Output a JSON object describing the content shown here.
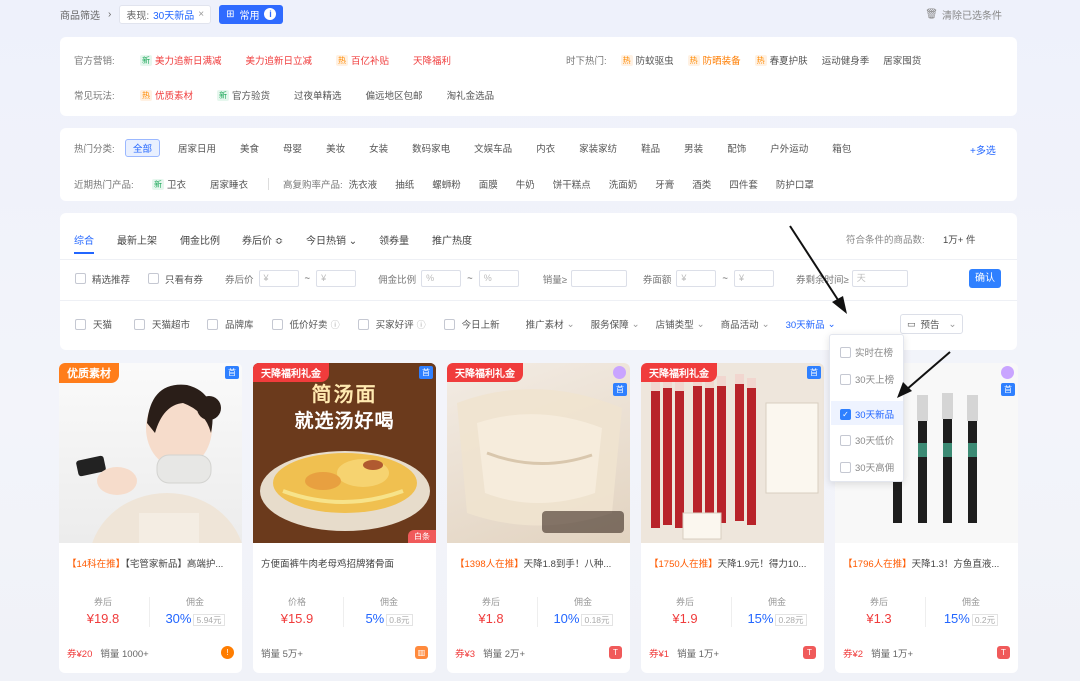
{
  "breadcrumb": {
    "root": "商品筛选",
    "chip_prefix": "表现:",
    "chip_value": "30天新品",
    "common_label": "常用",
    "clear_label": "清除已选条件"
  },
  "marketing": {
    "label": "官方营销:",
    "items": [
      {
        "badge": "新",
        "text": "美力追新日满减"
      },
      {
        "text": "美力追新日立减"
      },
      {
        "badge": "热",
        "text": "百亿补贴"
      },
      {
        "text": "天降福利"
      }
    ],
    "hot_label": "时下热门:",
    "hot_items": [
      {
        "badge": "热",
        "text": "防蚊驱虫"
      },
      {
        "badge": "热",
        "text": "防晒装备"
      },
      {
        "badge": "热",
        "text": "春夏护肤"
      },
      {
        "text": "运动健身季"
      },
      {
        "text": "居家囤货"
      }
    ]
  },
  "gameplay": {
    "label": "常见玩法:",
    "items": [
      {
        "badge": "热",
        "text": "优质素材"
      },
      {
        "badge": "新",
        "text": "官方验货"
      },
      {
        "text": "过夜单精选"
      },
      {
        "text": "偏远地区包邮"
      },
      {
        "text": "淘礼金选品"
      }
    ]
  },
  "categories": {
    "label": "热门分类:",
    "items": [
      "全部",
      "居家日用",
      "美食",
      "母婴",
      "美妆",
      "女装",
      "数码家电",
      "文娱车品",
      "内衣",
      "家装家纺",
      "鞋品",
      "男装",
      "配饰",
      "户外运动",
      "箱包"
    ],
    "more": "+多选"
  },
  "recent": {
    "label": "近期热门产品:",
    "items": [
      {
        "badge": "新",
        "text": "卫衣"
      },
      {
        "text": "居家睡衣"
      }
    ],
    "high_label": "高复购率产品:",
    "high_items": [
      "洗衣液",
      "抽纸",
      "螺蛳粉",
      "面膜",
      "牛奶",
      "饼干糕点",
      "洗面奶",
      "牙膏",
      "酒类",
      "四件套",
      "防护口罩"
    ]
  },
  "sort": {
    "tabs": [
      "综合",
      "最新上架",
      "佣金比例",
      "券后价 ≎",
      "今日热销 ⌄",
      "领券量",
      "推广热度"
    ],
    "count_label": "符合条件的商品数:",
    "count_value": "1万+ 件"
  },
  "filters": {
    "featured": "精选推荐",
    "coupon_only": "只看有券",
    "after_price": "券后价",
    "yen": "¥",
    "tilde": "~",
    "commission_rate": "佣金比例",
    "pct": "%",
    "sales": "销量≥",
    "coupon_value": "券面额",
    "coupon_time": "券剩余时间≥",
    "day": "天",
    "confirm": "确认"
  },
  "filters2": {
    "checks": [
      "天猫",
      "天猫超市",
      "品牌库",
      "低价好卖",
      "买家好评",
      "今日上新"
    ],
    "dropdowns": [
      "推广素材",
      "服务保障",
      "店铺类型",
      "商品活动"
    ],
    "active_dropdown": "30天新品",
    "preview": "预告"
  },
  "dropdown": {
    "items": [
      "实时在榜",
      "30天上榜",
      "30天新品",
      "30天低价",
      "30天高佣"
    ],
    "selected": "30天新品"
  },
  "products": [
    {
      "corner": "优质素材",
      "corner_color": "#ff7d1a",
      "title_hl": "【14科在推】",
      "title": "【宅管家新品】高端护...",
      "stat_l": "券后",
      "price_l": "¥19.8",
      "stat_r": "佣金",
      "price_r": "30%",
      "price_r_small": "5.94元",
      "coupon": "券¥20",
      "sales": "销量 1000+",
      "icon_color": "#ff7d00"
    },
    {
      "corner": "天降福利礼金",
      "corner_color": "#f03c3c",
      "title_hl": "",
      "title": "方便面裤牛肉老母鸡招牌猪骨面",
      "stat_l": "价格",
      "price_l": "¥15.9",
      "stat_r": "佣金",
      "price_r": "5%",
      "price_r_small": "0.8元",
      "coupon": "",
      "sales": "销量 5万+",
      "icon_color": "#ff7d00",
      "extra_tag": "白条"
    },
    {
      "corner": "天降福利礼金",
      "corner_color": "#f03c3c",
      "title_hl": "【1398人在推】",
      "title": "天降1.8到手！八种...",
      "stat_l": "券后",
      "price_l": "¥1.8",
      "stat_r": "佣金",
      "price_r": "10%",
      "price_r_small": "0.18元",
      "coupon": "券¥3",
      "sales": "销量 2万+",
      "icon_color": "#f05a5a"
    },
    {
      "corner": "天降福利礼金",
      "corner_color": "#f03c3c",
      "title_hl": "【1750人在推】",
      "title": "天降1.9元！得力10...",
      "stat_l": "券后",
      "price_l": "¥1.9",
      "stat_r": "佣金",
      "price_r": "15%",
      "price_r_small": "0.28元",
      "coupon": "券¥1",
      "sales": "销量 1万+",
      "icon_color": "#f05a5a"
    },
    {
      "corner": "",
      "corner_color": "",
      "title_hl": "【1796人在推】",
      "title": "天降1.3！方鱼直液...",
      "stat_l": "券后",
      "price_l": "¥1.3",
      "stat_r": "佣金",
      "price_r": "15%",
      "price_r_small": "0.2元",
      "coupon": "券¥2",
      "sales": "销量 1万+",
      "icon_color": "#f05a5a"
    }
  ],
  "first_tag": "首",
  "img_texts": {
    "noodle_line1": "简汤面",
    "noodle_line2": "就选汤好喝"
  }
}
